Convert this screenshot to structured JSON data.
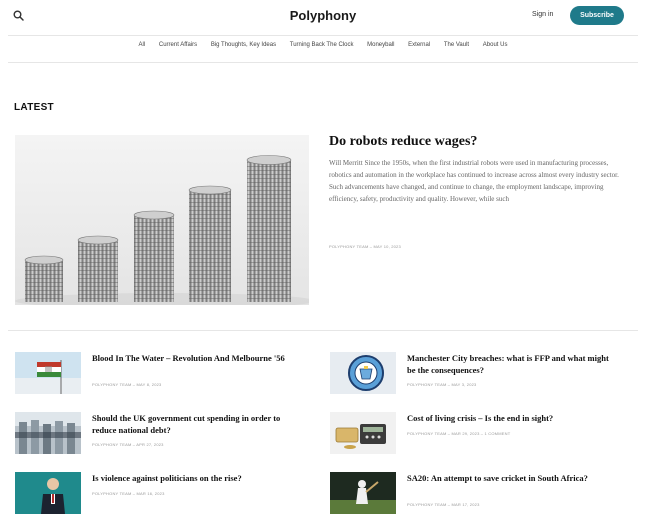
{
  "header": {
    "brand": "Polyphony",
    "signin_label": "Sign in",
    "subscribe_label": "Subscribe",
    "search_icon": "search-icon",
    "accent_color": "#1f7a8a"
  },
  "nav": {
    "items": [
      "All",
      "Current Affairs",
      "Big Thoughts, Key Ideas",
      "Turning Back The Clock",
      "Moneyball",
      "External",
      "The Vault",
      "About Us"
    ]
  },
  "latest": {
    "heading": "LATEST",
    "featured": {
      "title": "Do robots reduce wages?",
      "excerpt": "Will Merritt Since the 1950s, when the first industrial robots were used in manufacturing processes, robotics and automation in the workplace has continued to increase across almost every industry sector. Such advancements have changed, and continue to change, the employment landscape, improving efficiency, safety, productivity and quality. However, while such",
      "meta": "POLYPHONY TEAM – MAY 10, 2023"
    },
    "articles": [
      {
        "title": "Blood In The Water – Revolution And Melbourne '56",
        "meta": "POLYPHONY TEAM – MAY 8, 2023"
      },
      {
        "title": "Manchester City breaches: what is FFP and what might be the consequences?",
        "meta": "POLYPHONY TEAM – MAY 3, 2023"
      },
      {
        "title": "Should the UK government cut spending in order to reduce national debt?",
        "meta": "POLYPHONY TEAM – APR 27, 2023"
      },
      {
        "title": "Cost of living crisis – Is the end in sight?",
        "meta": "POLYPHONY TEAM – MAR 29, 2023 – 1 COMMENT"
      },
      {
        "title": "Is violence against politicians on the rise?",
        "meta": "POLYPHONY TEAM – MAR 16, 2023"
      },
      {
        "title": "SA20: An attempt to save cricket in South Africa?",
        "meta": "POLYPHONY TEAM – MAR 17, 2023"
      }
    ]
  }
}
